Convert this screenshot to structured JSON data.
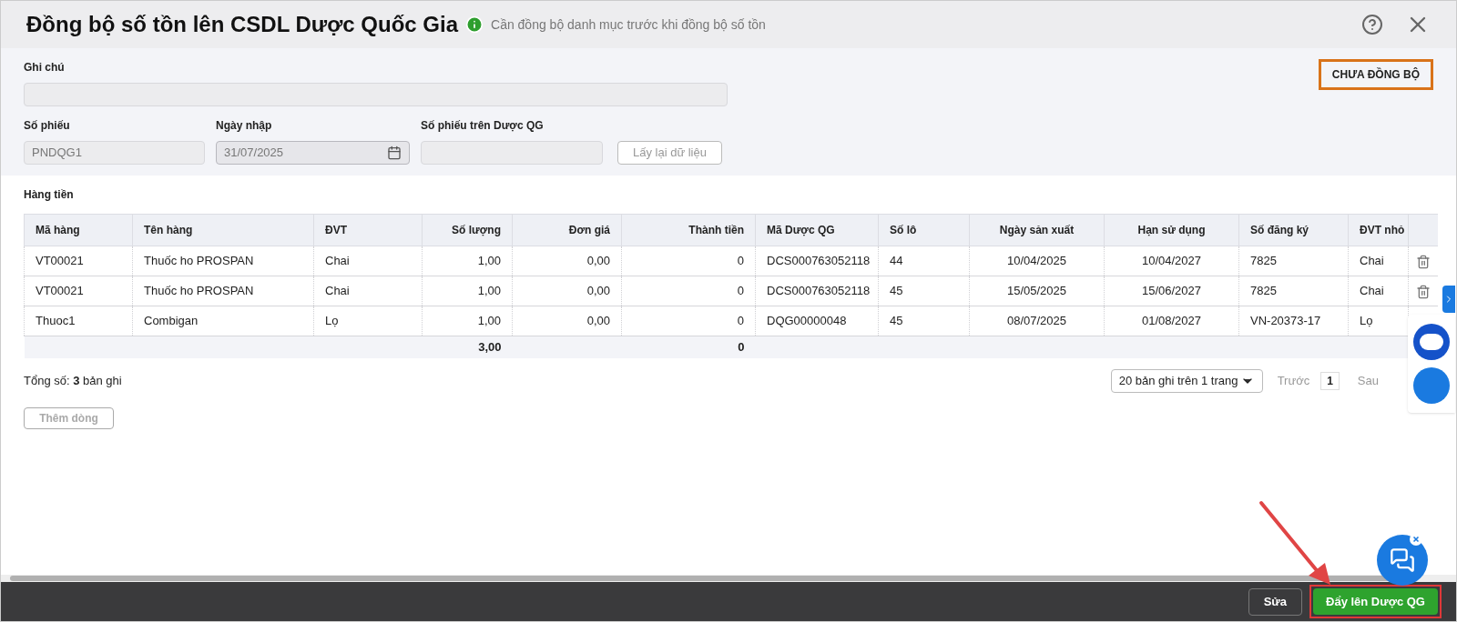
{
  "window": {
    "title": "Đồng bộ số tồn lên CSDL Dược Quốc Gia",
    "hint": "Cần đồng bộ danh mục trước khi đồng bộ số tồn"
  },
  "status_badge": "CHƯA ĐỒNG BỘ",
  "form": {
    "note": {
      "label": "Ghi chú"
    },
    "fields": [
      {
        "label": "Số phiếu",
        "value": "PNDQG1",
        "kind": "text"
      },
      {
        "label": "Ngày nhập",
        "value": "31/07/2025",
        "kind": "date"
      },
      {
        "label": "Số phiếu trên Dược QG",
        "kind": "text"
      }
    ],
    "reload_button": {
      "label": "Lấy lại dữ liệu",
      "disabled": true
    }
  },
  "section_title": "Hàng tiền",
  "table": {
    "columns": [
      "Mã hàng",
      "Tên hàng",
      "ĐVT",
      "Số lượng",
      "Đơn giá",
      "Thành tiền",
      "Mã Dược QG",
      "Số lô",
      "Ngày sản xuất",
      "Hạn sử dụng",
      "Số đăng ký",
      "ĐVT nhỏ"
    ],
    "rows": [
      [
        "VT00021",
        "Thuốc ho PROSPAN",
        "Chai",
        "1,00",
        "0,00",
        "0",
        "DCS000763052118",
        "44",
        "10/04/2025",
        "10/04/2027",
        "7825",
        "Chai"
      ],
      [
        "VT00021",
        "Thuốc ho PROSPAN",
        "Chai",
        "1,00",
        "0,00",
        "0",
        "DCS000763052118",
        "45",
        "15/05/2025",
        "15/06/2027",
        "7825",
        "Chai"
      ],
      [
        "Thuoc1",
        "Combigan",
        "Lọ",
        "1,00",
        "0,00",
        "0",
        "DQG00000048",
        "45",
        "08/07/2025",
        "01/08/2027",
        "VN-20373-17",
        "Lọ"
      ]
    ],
    "totals": {
      "quantity": "3,00",
      "amount": "0"
    }
  },
  "record_count": "Tổng số: **3** bản ghi",
  "add_row_button": {
    "label": "Thêm dòng",
    "disabled": true
  },
  "pagination": {
    "page_size": "20 bản ghi trên 1 trang",
    "prev": "Trước",
    "page": "1",
    "next": "Sau"
  },
  "footer": {
    "edit_button": "Sửa",
    "push_button": "Đẩy lên Dược QG"
  }
}
